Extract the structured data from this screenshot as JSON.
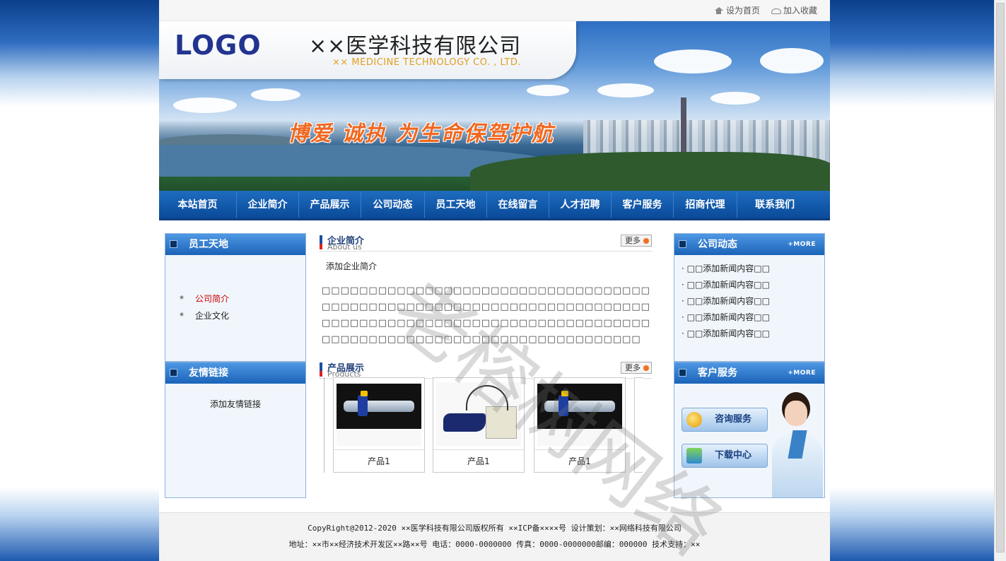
{
  "topbar": {
    "set_home": "设为首页",
    "add_favorite": "加入收藏"
  },
  "header": {
    "logo": "LOGO",
    "company_cn": "××医学科技有限公司",
    "company_en": "×× MEDICINE TECHNOLOGY CO. , LTD.",
    "slogan": "博爱  诚执  为生命保驾护航"
  },
  "nav": {
    "items": [
      "本站首页",
      "企业简介",
      "产品展示",
      "公司动态",
      "员工天地",
      "在线留言",
      "人才招聘",
      "客户服务",
      "招商代理",
      "联系我们"
    ]
  },
  "left": {
    "staff": {
      "title": "员工天地",
      "items": [
        {
          "star": "*",
          "label": "公司简介"
        },
        {
          "star": "*",
          "label": "企业文化"
        }
      ]
    },
    "links": {
      "title": "友情链接",
      "text": "添加友情链接"
    }
  },
  "main": {
    "about": {
      "title_cn": "企业简介",
      "title_en": "About us",
      "more": "更多",
      "line1": "添加企业简介",
      "body": "□□□□□□□□□□□□□□□□□□□□□□□□□□□□□□□□□□□□□□□□□□□□□□□□□□□□□□□□□□□□□□□□□□□□□□□□□□□□□□□□□□□□□□□□□□□□□□□□□□□□□□□□□□□□□□□□□□□□□□□□□□□□□□□□□□□□□□□□□□□"
    },
    "products": {
      "title_cn": "产品展示",
      "title_en": "Products",
      "more": "更多",
      "items": [
        "产品1",
        "产品1",
        "产品1"
      ]
    }
  },
  "right": {
    "news": {
      "title": "公司动态",
      "more": "+MORE",
      "items": [
        "· □□添加新闻内容□□",
        "· □□添加新闻内容□□",
        "· □□添加新闻内容□□",
        "· □□添加新闻内容□□",
        "· □□添加新闻内容□□"
      ]
    },
    "service": {
      "title": "客户服务",
      "more": "+MORE",
      "consult": "咨询服务",
      "download": "下载中心"
    }
  },
  "footer": {
    "line1": "CopyRight@2012-2020 ××医学科技有限公司版权所有 ××ICP备××××号 设计策划：××网络科技有限公司",
    "line2": "地址：××市××经济技术开发区××路××号 电话：0000-0000000 传真：0000-0000000邮编：000000 技术支持：××"
  },
  "watermark": "老榕树网络"
}
